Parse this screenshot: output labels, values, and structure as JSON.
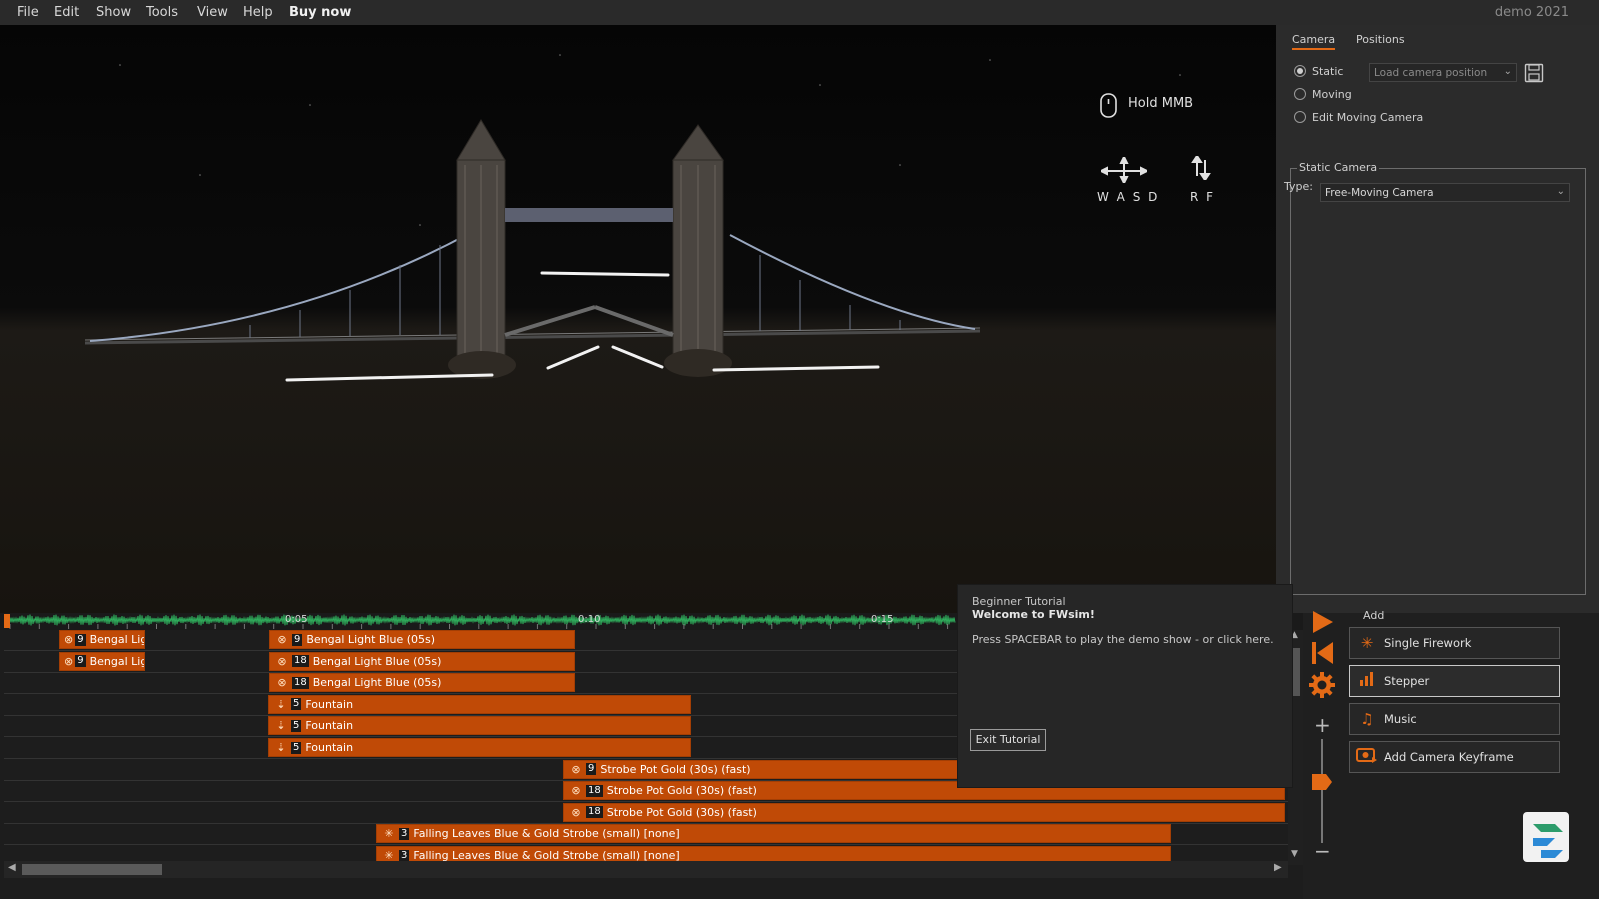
{
  "menu": {
    "items": [
      "File",
      "Edit",
      "Show",
      "Tools",
      "View",
      "Help"
    ],
    "buy_now": "Buy now",
    "edition": "demo 2021"
  },
  "viewport": {
    "hint_mouse": "Hold MMB",
    "hint_wasd": "W A S D",
    "hint_rf": "R  F"
  },
  "camera_panel": {
    "tabs": [
      "Camera",
      "Positions"
    ],
    "modes": [
      "Static",
      "Moving",
      "Edit Moving Camera"
    ],
    "selected_mode": "Static",
    "load_position_placeholder": "Load camera position",
    "static_group_title": "Static Camera",
    "type_label": "Type:",
    "type_value": "Free-Moving Camera"
  },
  "timeline": {
    "time_labels": [
      "0:05",
      "0:10",
      "0:15"
    ],
    "rows": [
      [
        {
          "icon": "bengal-icon",
          "count": "9",
          "label": "Bengal Lig"
        },
        {
          "icon": "bengal-icon",
          "count": "9",
          "label": "Bengal Light Blue (05s)"
        }
      ],
      [
        {
          "icon": "bengal-icon",
          "count": "9",
          "label": "Bengal Lig"
        },
        {
          "icon": "bengal-icon",
          "count": "18",
          "label": "Bengal Light Blue (05s)"
        }
      ],
      [
        {
          "icon": "bengal-icon",
          "count": "18",
          "label": "Bengal Light Blue (05s)"
        }
      ],
      [
        {
          "icon": "fountain-icon",
          "count": "5",
          "label": "Fountain"
        }
      ],
      [
        {
          "icon": "fountain-icon",
          "count": "5",
          "label": "Fountain"
        }
      ],
      [
        {
          "icon": "fountain-icon",
          "count": "5",
          "label": "Fountain"
        }
      ],
      [
        {
          "icon": "bengal-icon",
          "count": "9",
          "label": "Strobe Pot Gold (30s) (fast)"
        }
      ],
      [
        {
          "icon": "bengal-icon",
          "count": "18",
          "label": "Strobe Pot Gold (30s) (fast)"
        }
      ],
      [
        {
          "icon": "bengal-icon",
          "count": "18",
          "label": "Strobe Pot Gold (30s) (fast)"
        }
      ],
      [
        {
          "icon": "burst-icon",
          "count": "3",
          "label": "Falling Leaves Blue & Gold Strobe (small) [none]"
        }
      ],
      [
        {
          "icon": "burst-icon",
          "count": "3",
          "label": "Falling Leaves Blue & Gold Strobe (small) [none]"
        }
      ]
    ]
  },
  "add_panel": {
    "title": "Add",
    "buttons": [
      "Single Firework",
      "Stepper",
      "Music",
      "Add Camera Keyframe"
    ]
  },
  "tutorial": {
    "subtitle": "Beginner Tutorial",
    "title": "Welcome to FWsim!",
    "body": "Press SPACEBAR to play the demo show - or click here.",
    "exit_label": "Exit Tutorial"
  },
  "colors": {
    "accent": "#e36a16",
    "bar": "#c04a06",
    "waveform": "#2fae5c"
  }
}
